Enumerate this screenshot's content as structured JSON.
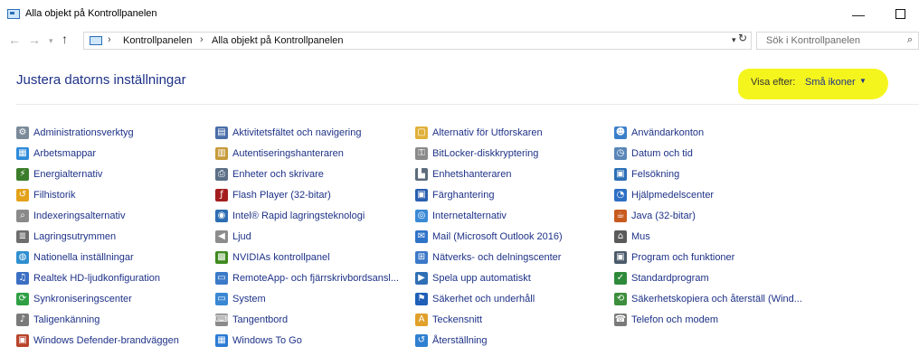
{
  "window": {
    "title": "Alla objekt på Kontrollpanelen",
    "minimize": "—",
    "close": "✕"
  },
  "address": {
    "crumbs": [
      "Kontrollpanelen",
      "Alla objekt på Kontrollpanelen"
    ],
    "search_placeholder": "Sök i Kontrollpanelen"
  },
  "header": {
    "title": "Justera datorns inställningar",
    "view_label": "Visa efter:",
    "view_value": "Små ikoner"
  },
  "columns": [
    [
      {
        "label": "Administrationsverktyg",
        "icon": "admin-tools-icon",
        "color": "#7a8a99",
        "glyph": "⚙"
      },
      {
        "label": "Arbetsmappar",
        "icon": "work-folders-icon",
        "color": "#2e8ad8",
        "glyph": "▦"
      },
      {
        "label": "Energialternativ",
        "icon": "power-options-icon",
        "color": "#3b7d2a",
        "glyph": "⚡"
      },
      {
        "label": "Filhistorik",
        "icon": "file-history-icon",
        "color": "#e3a21a",
        "glyph": "↺"
      },
      {
        "label": "Indexeringsalternativ",
        "icon": "indexing-icon",
        "color": "#8a8a8a",
        "glyph": "⌕"
      },
      {
        "label": "Lagringsutrymmen",
        "icon": "storage-spaces-icon",
        "color": "#6e6e6e",
        "glyph": "≣"
      },
      {
        "label": "Nationella inställningar",
        "icon": "region-icon",
        "color": "#2f8fd0",
        "glyph": "◍"
      },
      {
        "label": "Realtek HD-ljudkonfiguration",
        "icon": "realtek-audio-icon",
        "color": "#3b6fc4",
        "glyph": "♫"
      },
      {
        "label": "Synkroniseringscenter",
        "icon": "sync-center-icon",
        "color": "#2ea043",
        "glyph": "⟳"
      },
      {
        "label": "Taligenkänning",
        "icon": "speech-recognition-icon",
        "color": "#7a7a7a",
        "glyph": "♪"
      },
      {
        "label": "Windows Defender-brandväggen",
        "icon": "firewall-icon",
        "color": "#b8432b",
        "glyph": "▣"
      }
    ],
    [
      {
        "label": "Aktivitetsfältet och navigering",
        "icon": "taskbar-icon",
        "color": "#4a6ea8",
        "glyph": "▤"
      },
      {
        "label": "Autentiseringshanteraren",
        "icon": "credential-manager-icon",
        "color": "#c79a3b",
        "glyph": "▥"
      },
      {
        "label": "Enheter och skrivare",
        "icon": "devices-printers-icon",
        "color": "#5b6f86",
        "glyph": "⎙"
      },
      {
        "label": "Flash Player (32-bitar)",
        "icon": "flash-player-icon",
        "color": "#a41e1e",
        "glyph": "ƒ"
      },
      {
        "label": "Intel® Rapid lagringsteknologi",
        "icon": "intel-rst-icon",
        "color": "#2f6db2",
        "glyph": "◉"
      },
      {
        "label": "Ljud",
        "icon": "sound-icon",
        "color": "#8d8d8d",
        "glyph": "◀"
      },
      {
        "label": "NVIDIAs kontrollpanel",
        "icon": "nvidia-icon",
        "color": "#3f8a1e",
        "glyph": "▩"
      },
      {
        "label": "RemoteApp- och fjärrskrivbordsansl...",
        "icon": "remoteapp-icon",
        "color": "#3a7ac8",
        "glyph": "▭"
      },
      {
        "label": "System",
        "icon": "system-icon",
        "color": "#3a87d4",
        "glyph": "▭"
      },
      {
        "label": "Tangentbord",
        "icon": "keyboard-icon",
        "color": "#8b8b8b",
        "glyph": "⌨"
      },
      {
        "label": "Windows To Go",
        "icon": "windows-to-go-icon",
        "color": "#2b7bd3",
        "glyph": "▦"
      }
    ],
    [
      {
        "label": "Alternativ för Utforskaren",
        "icon": "explorer-options-icon",
        "color": "#e0b13a",
        "glyph": "▢"
      },
      {
        "label": "BitLocker-diskkryptering",
        "icon": "bitlocker-icon",
        "color": "#8a8a8a",
        "glyph": "⚿"
      },
      {
        "label": "Enhetshanteraren",
        "icon": "device-manager-icon",
        "color": "#5c6c7c",
        "glyph": "▙"
      },
      {
        "label": "Färghantering",
        "icon": "color-management-icon",
        "color": "#2a5fb0",
        "glyph": "▣"
      },
      {
        "label": "Internetalternativ",
        "icon": "internet-options-icon",
        "color": "#3a8ad6",
        "glyph": "◎"
      },
      {
        "label": "Mail (Microsoft Outlook 2016)",
        "icon": "mail-icon",
        "color": "#2f73c8",
        "glyph": "✉"
      },
      {
        "label": "Nätverks- och delningscenter",
        "icon": "network-center-icon",
        "color": "#3b78c9",
        "glyph": "⊞"
      },
      {
        "label": "Spela upp automatiskt",
        "icon": "autoplay-icon",
        "color": "#2f6fb5",
        "glyph": "▶"
      },
      {
        "label": "Säkerhet och underhåll",
        "icon": "security-maintenance-icon",
        "color": "#1f5fb8",
        "glyph": "⚑"
      },
      {
        "label": "Teckensnitt",
        "icon": "fonts-icon",
        "color": "#e0a02a",
        "glyph": "A"
      },
      {
        "label": "Återställning",
        "icon": "recovery-icon",
        "color": "#2f80d0",
        "glyph": "↺"
      }
    ],
    [
      {
        "label": "Användarkonton",
        "icon": "user-accounts-icon",
        "color": "#3b7fc9",
        "glyph": "☻"
      },
      {
        "label": "Datum och tid",
        "icon": "date-time-icon",
        "color": "#5a86b8",
        "glyph": "◷"
      },
      {
        "label": "Felsökning",
        "icon": "troubleshooting-icon",
        "color": "#2c6fb6",
        "glyph": "▣"
      },
      {
        "label": "Hjälpmedelscenter",
        "icon": "ease-of-access-icon",
        "color": "#2f6fc4",
        "glyph": "◔"
      },
      {
        "label": "Java (32-bitar)",
        "icon": "java-icon",
        "color": "#c75b1e",
        "glyph": "☕"
      },
      {
        "label": "Mus",
        "icon": "mouse-icon",
        "color": "#5a5a5a",
        "glyph": "⌂"
      },
      {
        "label": "Program och funktioner",
        "icon": "programs-features-icon",
        "color": "#4b5a6a",
        "glyph": "▣"
      },
      {
        "label": "Standardprogram",
        "icon": "default-programs-icon",
        "color": "#2e8a3a",
        "glyph": "✓"
      },
      {
        "label": "Säkerhetskopiera och återställ (Wind...",
        "icon": "backup-restore-icon",
        "color": "#3d8e3d",
        "glyph": "⟲"
      },
      {
        "label": "Telefon och modem",
        "icon": "phone-modem-icon",
        "color": "#7a7a7a",
        "glyph": "☎"
      }
    ]
  ]
}
